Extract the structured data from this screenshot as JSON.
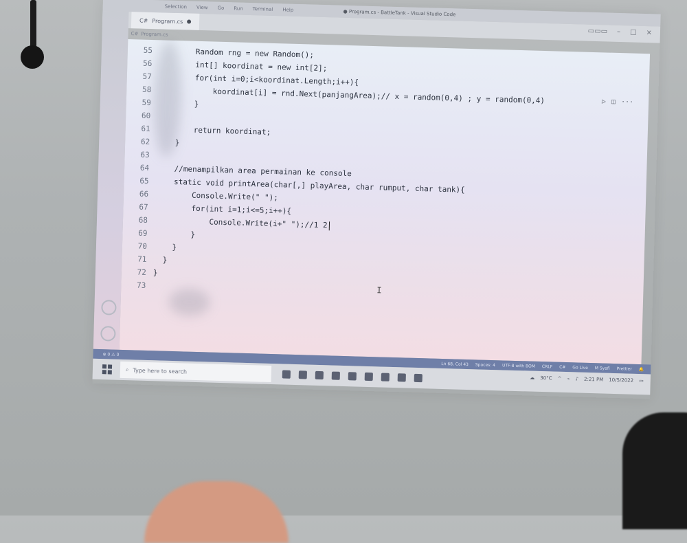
{
  "menubar": {
    "items": [
      "Selection",
      "View",
      "Go",
      "Run",
      "Terminal",
      "Help"
    ],
    "window_title": "● Program.cs - BattleTank - Visual Studio Code"
  },
  "tab": {
    "label": "Program.cs"
  },
  "breadcrumb": {
    "label": "Program.cs"
  },
  "editor": {
    "lines": [
      {
        "num": "55",
        "text": "        Random rng = new Random();"
      },
      {
        "num": "56",
        "text": "        int[] koordinat = new int[2];"
      },
      {
        "num": "57",
        "text": "        for(int i=0;i<koordinat.Length;i++){"
      },
      {
        "num": "58",
        "text": "            koordinat[i] = rnd.Next(panjangArea);// x = random(0,4) ; y = random(0,4)"
      },
      {
        "num": "59",
        "text": "        }"
      },
      {
        "num": "60",
        "text": ""
      },
      {
        "num": "61",
        "text": "        return koordinat;"
      },
      {
        "num": "62",
        "text": "    }"
      },
      {
        "num": "63",
        "text": ""
      },
      {
        "num": "64",
        "text": "    //menampilkan area permainan ke console"
      },
      {
        "num": "65",
        "text": "    static void printArea(char[,] playArea, char rumput, char tank){"
      },
      {
        "num": "66",
        "text": "        Console.Write(\" \");"
      },
      {
        "num": "67",
        "text": "        for(int i=1;i<=5;i++){"
      },
      {
        "num": "68",
        "text": "            Console.Write(i+\" \");//1 2"
      },
      {
        "num": "69",
        "text": "        }"
      },
      {
        "num": "70",
        "text": "    }"
      },
      {
        "num": "71",
        "text": "  }"
      },
      {
        "num": "72",
        "text": "}"
      },
      {
        "num": "73",
        "text": ""
      }
    ]
  },
  "statusbar": {
    "position": "Ln 68, Col 43",
    "spaces": "Spaces: 4",
    "encoding": "UTF-8 with BOM",
    "eol": "CRLF",
    "language": "C#",
    "golive": "Go Live",
    "user": "M Syafi",
    "prettier": "Prettier"
  },
  "taskbar": {
    "search_placeholder": "Type here to search",
    "temperature": "30°C",
    "time": "2:21 PM",
    "date": "10/5/2022"
  }
}
